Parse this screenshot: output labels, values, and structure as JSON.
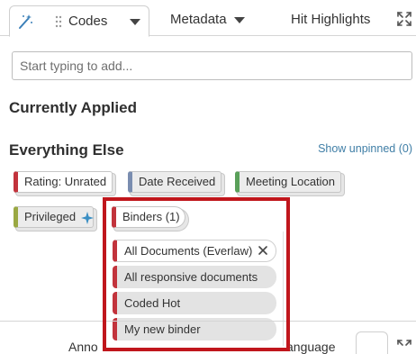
{
  "tabs": {
    "codes": "Codes",
    "metadata": "Metadata",
    "hit_highlights": "Hit Highlights"
  },
  "search": {
    "placeholder": "Start typing to add..."
  },
  "sections": {
    "currently_applied": "Currently Applied",
    "everything_else": "Everything Else",
    "show_unpinned": "Show unpinned (0)"
  },
  "chips": [
    {
      "label": "Rating: Unrated",
      "color": "#c2333c"
    },
    {
      "label": "Date Received",
      "color": "#7a8db0"
    },
    {
      "label": "Meeting Location",
      "color": "#5aa05a"
    },
    {
      "label": "Privileged",
      "color": "#9aa843"
    },
    {
      "label": "Binders (1)",
      "color": "#c2333c"
    }
  ],
  "binders": [
    {
      "label": "All Documents (Everlaw)",
      "selected": true
    },
    {
      "label": "All responsive documents",
      "selected": false
    },
    {
      "label": "Coded Hot",
      "selected": false
    },
    {
      "label": "My new binder",
      "selected": false
    }
  ],
  "bottom": {
    "left_text": "Anno",
    "right_text": "anguage"
  },
  "colors": {
    "highlight": "#c0161c",
    "link": "#3f7ea6",
    "sparkle": "#3a8fc4"
  }
}
